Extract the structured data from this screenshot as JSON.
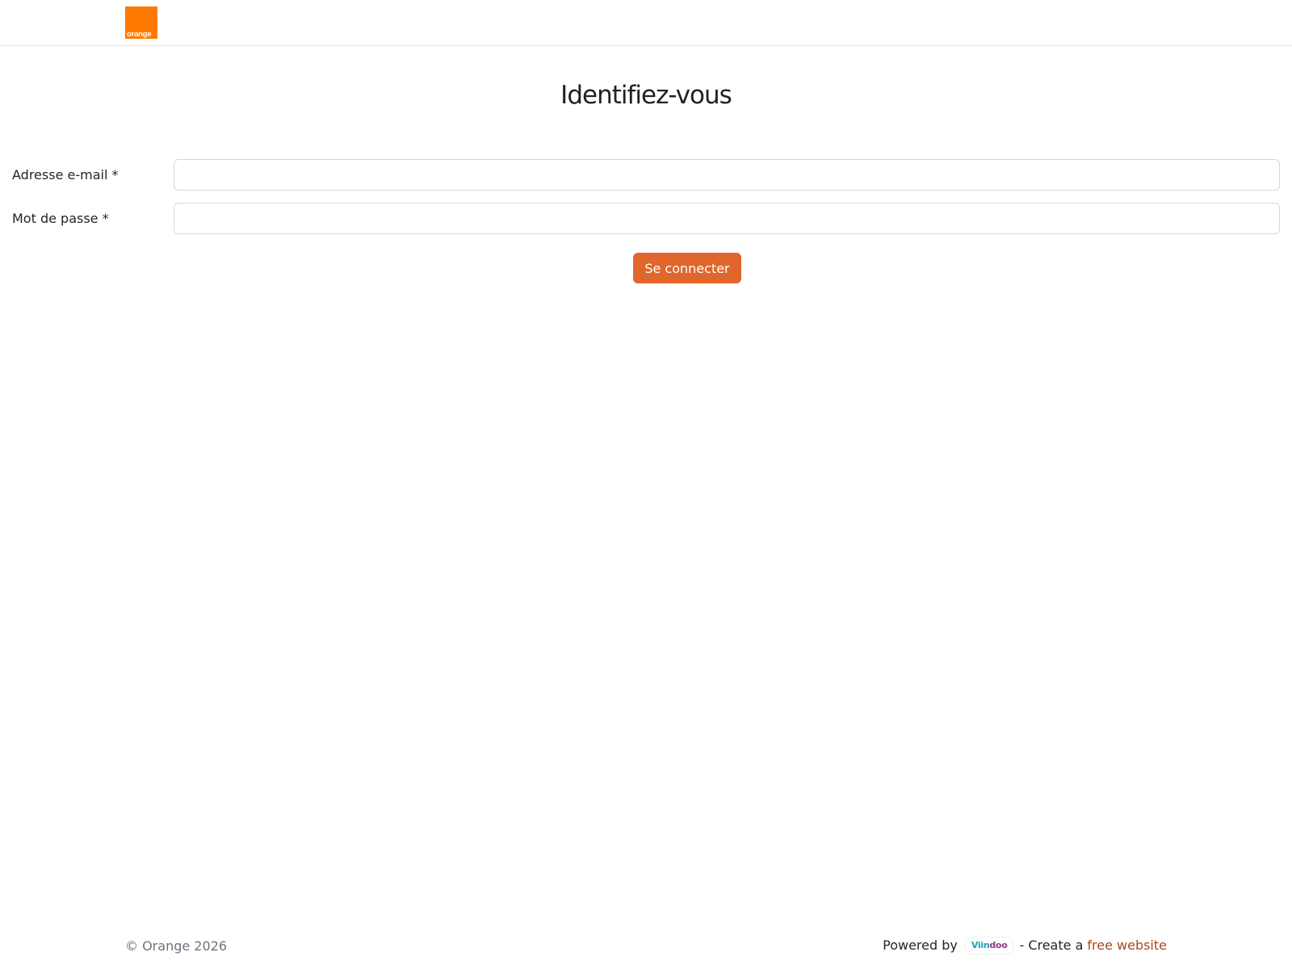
{
  "header": {
    "logo_text": "orange",
    "brand_color": "#ff7900"
  },
  "main": {
    "title": "Identifiez-vous",
    "email_label": "Adresse e-mail *",
    "email_value": "",
    "password_label": "Mot de passe *",
    "password_value": "",
    "submit_label": "Se connecter",
    "button_color": "#e0662b"
  },
  "footer": {
    "copyright": "© Orange 2026",
    "powered_by": "Powered by",
    "viindoo_part1": "Viin",
    "viindoo_part2": "doo",
    "create_text": "- Create a",
    "free_link": "free website",
    "link_color": "#a64a1c"
  }
}
